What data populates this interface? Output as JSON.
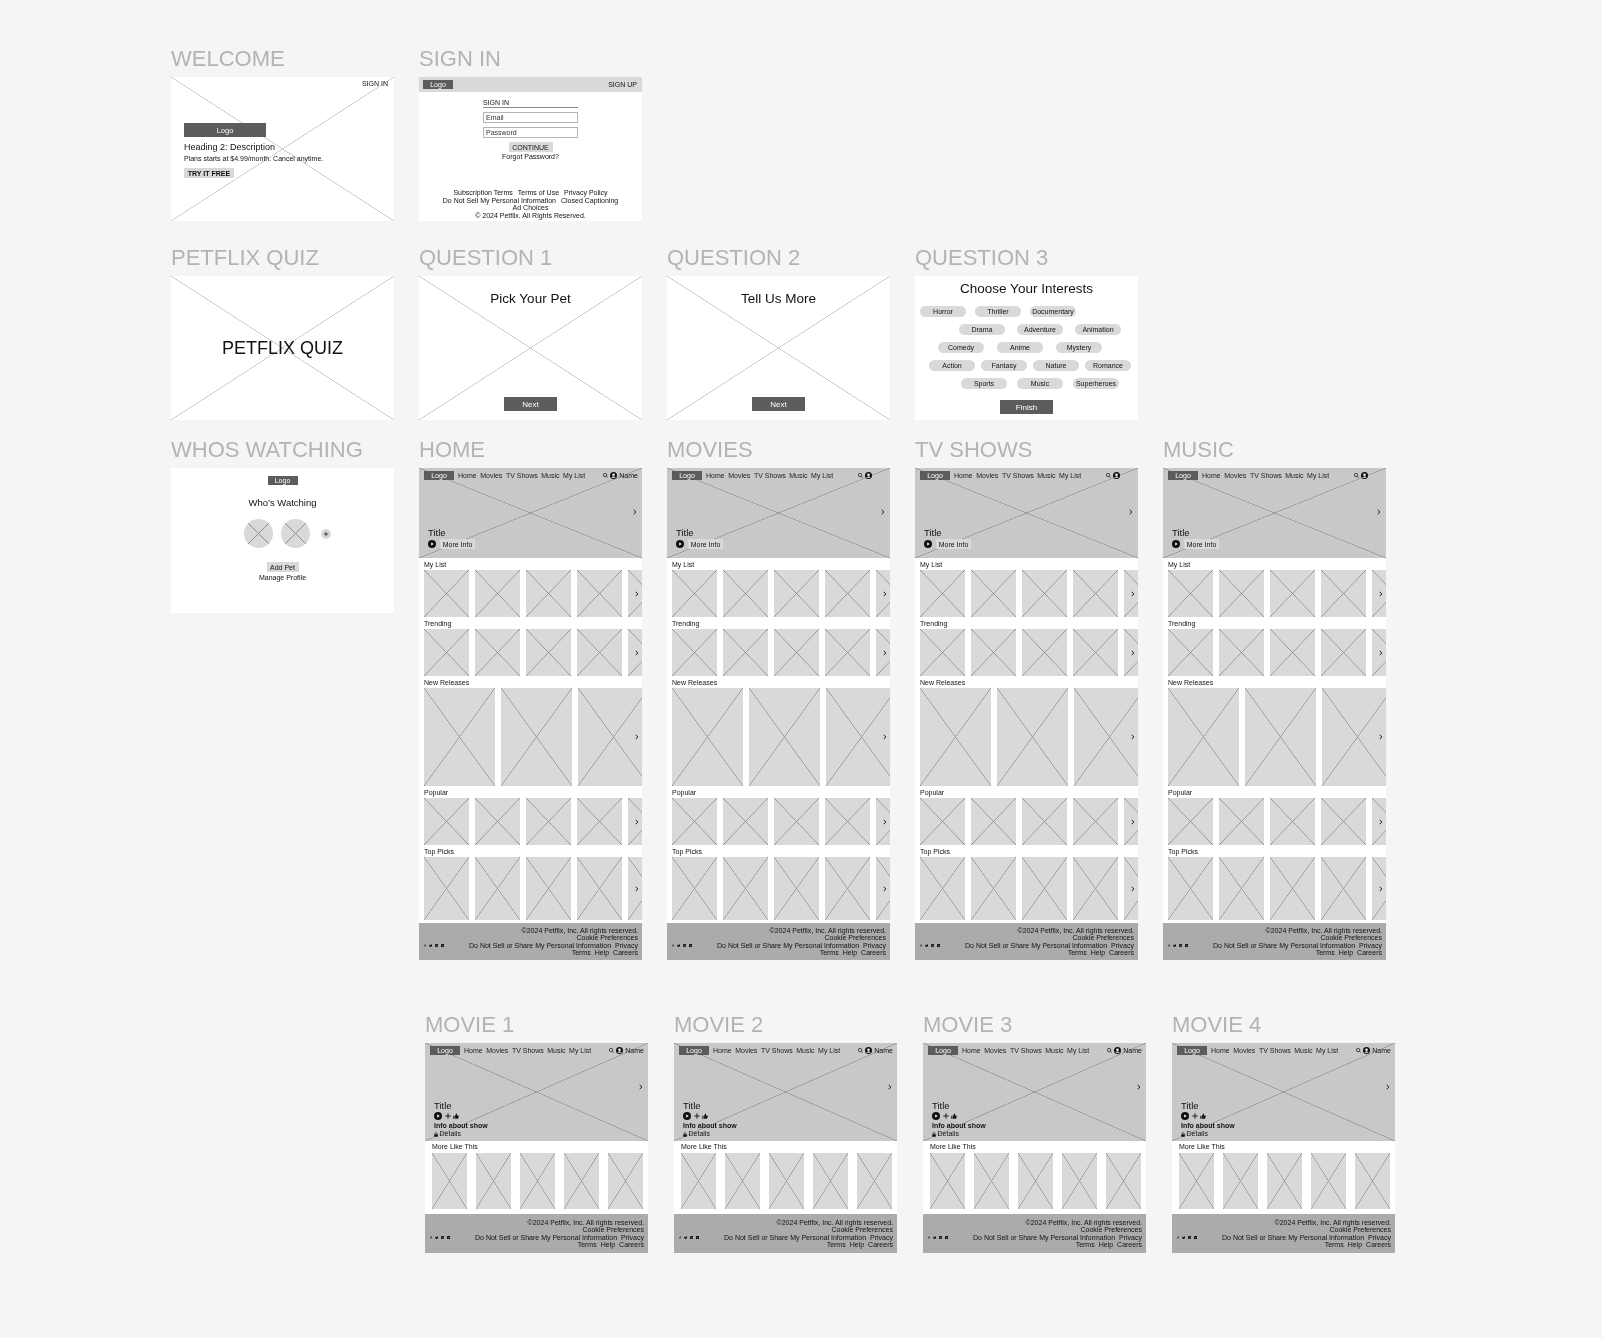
{
  "canvas": {
    "rows": [
      {
        "frames": [
          {
            "kind": "welcome",
            "label": "WELCOME",
            "sign_in": "SIGN IN",
            "logo": "Logo",
            "heading": "Heading 2: Description",
            "text": "Plans starts at $4.99/month. Cancel anytime.",
            "button": "TRY IT FREE"
          },
          {
            "kind": "sign_in",
            "label": "SIGN IN",
            "logo": "Logo",
            "sign_up": "SIGN UP",
            "form_title": "SIGN IN",
            "email_placeholder": "Email",
            "password_placeholder": "Password",
            "button": "CONTINUE",
            "forgot": "Forgot Password?",
            "footer_links": [
              "Subscription Terms",
              "Terms of Use",
              "Privacy Policy",
              "Do Not Sell My Personal Information",
              "Closed Captioning",
              "Ad Choices"
            ],
            "copyright": "© 2024 Petflix. All Rights Reserved."
          }
        ]
      },
      {
        "frames": [
          {
            "kind": "title_card",
            "label": "PETFLIX QUIZ",
            "title": "PETFLIX QUIZ"
          },
          {
            "kind": "question",
            "label": "QUESTION 1",
            "title": "Pick Your Pet",
            "button": "Next"
          },
          {
            "kind": "question",
            "label": "QUESTION 2",
            "title": "Tell Us More",
            "button": "Next"
          },
          {
            "kind": "interests",
            "label": "QUESTION 3",
            "title": "Choose Your Interests",
            "chip_rows": [
              [
                "Horror",
                "Thriller",
                "Documentary"
              ],
              [
                "Drama",
                "Adventure",
                "Animation"
              ],
              [
                "Comedy",
                "Anime",
                "Mystery"
              ],
              [
                "Action",
                "Fantasy",
                "Nature",
                "Romance"
              ],
              [
                "Sports",
                "Music",
                "Superheroes"
              ]
            ],
            "button": "Finish"
          }
        ]
      },
      {
        "frames": [
          {
            "kind": "profiles",
            "label": "WHOS WATCHING",
            "logo": "Logo",
            "title": "Who’s Watching",
            "profiles": [
              {
                "kind": "avatar"
              },
              {
                "kind": "avatar"
              },
              {
                "kind": "add"
              }
            ],
            "button": "Add Pet",
            "link": "Manage Profile"
          },
          {
            "kind": "browse",
            "label": "HOME",
            "nav": {
              "logo": "Logo",
              "links": [
                "Home",
                "Movies",
                "TV Shows",
                "Music",
                "My List"
              ],
              "account": "Name"
            },
            "hero": {
              "title": "Title",
              "button": "More Info"
            },
            "rails": [
              {
                "title": "My List",
                "kind": "square"
              },
              {
                "title": "Trending",
                "kind": "square"
              },
              {
                "title": "New Releases",
                "kind": "wide"
              },
              {
                "title": "Popular",
                "kind": "square"
              },
              {
                "title": "Top Picks",
                "kind": "portrait"
              }
            ],
            "footer": {
              "copyright": "©2024 Petflix, Inc. All rights reserved.",
              "links": [
                "Cookie Preferences",
                "Do Not Sell or Share My Personal Information",
                "Privacy",
                "Terms",
                "Help",
                "Careers"
              ]
            }
          },
          {
            "kind": "browse",
            "label": "MOVIES",
            "nav": {
              "logo": "Logo",
              "links": [
                "Home",
                "Movies",
                "TV Shows",
                "Music",
                "My List"
              ]
            },
            "hero": {
              "title": "Title",
              "button": "More Info"
            },
            "rails": [
              {
                "title": "My List",
                "kind": "square"
              },
              {
                "title": "Trending",
                "kind": "square"
              },
              {
                "title": "New Releases",
                "kind": "wide"
              },
              {
                "title": "Popular",
                "kind": "square"
              },
              {
                "title": "Top Picks",
                "kind": "portrait"
              }
            ],
            "footer": {
              "copyright": "©2024 Petflix, Inc. All rights reserved.",
              "links": [
                "Cookie Preferences",
                "Do Not Sell or Share My Personal Information",
                "Privacy",
                "Terms",
                "Help",
                "Careers"
              ]
            }
          },
          {
            "kind": "browse",
            "label": "TV SHOWS",
            "nav": {
              "logo": "Logo",
              "links": [
                "Home",
                "Movies",
                "TV Shows",
                "Music",
                "My List"
              ]
            },
            "hero": {
              "title": "Title",
              "button": "More Info"
            },
            "rails": [
              {
                "title": "My List",
                "kind": "square"
              },
              {
                "title": "Trending",
                "kind": "square"
              },
              {
                "title": "New Releases",
                "kind": "wide"
              },
              {
                "title": "Popular",
                "kind": "square"
              },
              {
                "title": "Top Picks",
                "kind": "portrait"
              }
            ],
            "footer": {
              "copyright": "©2024 Petflix, Inc. All rights reserved.",
              "links": [
                "Cookie Preferences",
                "Do Not Sell or Share My Personal Information",
                "Privacy",
                "Terms",
                "Help",
                "Careers"
              ]
            }
          },
          {
            "kind": "browse",
            "label": "MUSIC",
            "nav": {
              "logo": "Logo",
              "links": [
                "Home",
                "Movies",
                "TV Shows",
                "Music",
                "My List"
              ]
            },
            "hero": {
              "title": "Title",
              "button": "More Info"
            },
            "rails": [
              {
                "title": "My List",
                "kind": "square"
              },
              {
                "title": "Trending",
                "kind": "square"
              },
              {
                "title": "New Releases",
                "kind": "wide"
              },
              {
                "title": "Popular",
                "kind": "square"
              },
              {
                "title": "Top Picks",
                "kind": "portrait"
              }
            ],
            "footer": {
              "copyright": "©2024 Petflix, Inc. All rights reserved.",
              "links": [
                "Cookie Preferences",
                "Do Not Sell or Share My Personal Information",
                "Privacy",
                "Terms",
                "Help",
                "Careers"
              ]
            }
          }
        ]
      },
      {
        "frames": [
          {
            "kind": "detail",
            "label": "MOVIE 1",
            "nav": {
              "logo": "Logo",
              "links": [
                "Home",
                "Movies",
                "TV Shows",
                "Music",
                "My List"
              ],
              "account": "Name"
            },
            "hero": {
              "title": "Title",
              "info": "Info about show",
              "details": "Details"
            },
            "rails": [
              {
                "title": "More Like This",
                "kind": "poster"
              }
            ],
            "footer": {
              "copyright": "©2024 Petflix, Inc. All rights reserved.",
              "links": [
                "Cookie Preferences",
                "Do Not Sell or Share My Personal Information",
                "Privacy",
                "Terms",
                "Help",
                "Careers"
              ]
            }
          },
          {
            "kind": "detail",
            "label": "MOVIE 2",
            "nav": {
              "logo": "Logo",
              "links": [
                "Home",
                "Movies",
                "TV Shows",
                "Music",
                "My List"
              ],
              "account": "Name"
            },
            "hero": {
              "title": "Title",
              "info": "Info about show",
              "details": "Details"
            },
            "rails": [
              {
                "title": "More Like This",
                "kind": "poster"
              }
            ],
            "footer": {
              "copyright": "©2024 Petflix, Inc. All rights reserved.",
              "links": [
                "Cookie Preferences",
                "Do Not Sell or Share My Personal Information",
                "Privacy",
                "Terms",
                "Help",
                "Careers"
              ]
            }
          },
          {
            "kind": "detail",
            "label": "MOVIE 3",
            "nav": {
              "logo": "Logo",
              "links": [
                "Home",
                "Movies",
                "TV Shows",
                "Music",
                "My List"
              ],
              "account": "Name"
            },
            "hero": {
              "title": "Title",
              "info": "Info about show",
              "details": "Details"
            },
            "rails": [
              {
                "title": "More Like This",
                "kind": "poster"
              }
            ],
            "footer": {
              "copyright": "©2024 Petflix, Inc. All rights reserved.",
              "links": [
                "Cookie Preferences",
                "Do Not Sell or Share My Personal Information",
                "Privacy",
                "Terms",
                "Help",
                "Careers"
              ]
            }
          },
          {
            "kind": "detail",
            "label": "MOVIE 4",
            "nav": {
              "logo": "Logo",
              "links": [
                "Home",
                "Movies",
                "TV Shows",
                "Music",
                "My List"
              ],
              "account": "Name"
            },
            "hero": {
              "title": "Title",
              "info": "Info about show",
              "details": "Details"
            },
            "rails": [
              {
                "title": "More Like This",
                "kind": "poster"
              }
            ],
            "footer": {
              "copyright": "©2024 Petflix, Inc. All rights reserved.",
              "links": [
                "Cookie Preferences",
                "Do Not Sell or Share My Personal Information",
                "Privacy",
                "Terms",
                "Help",
                "Careers"
              ]
            }
          }
        ]
      }
    ]
  }
}
